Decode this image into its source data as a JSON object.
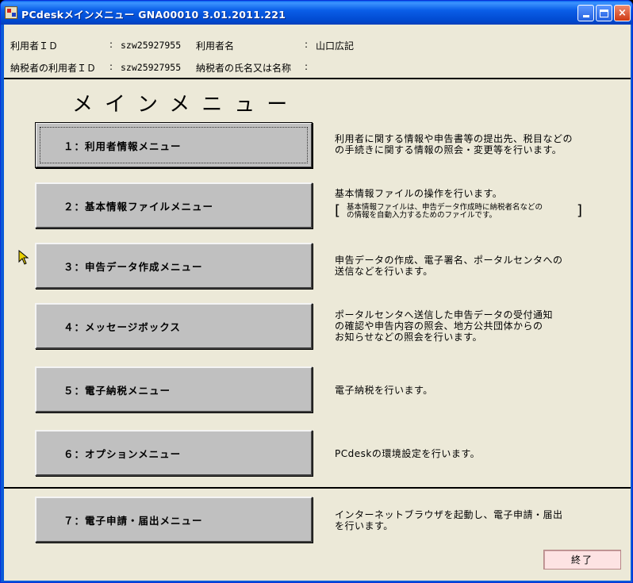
{
  "window": {
    "title": "PCdeskメインメニュー GNA00010  3.01.2011.221",
    "controls": {
      "minimize": "minimize-icon",
      "maximize": "maximize-icon",
      "close": "×"
    }
  },
  "header": {
    "user_id_label": "利用者ＩＤ",
    "user_id_sep": ":",
    "user_id_value": "szw25927955",
    "user_name_label": "利用者名",
    "user_name_sep": ":",
    "user_name_value": "山口広記",
    "taxpayer_id_label": "納税者の利用者ＩＤ",
    "taxpayer_id_sep": ":",
    "taxpayer_id_value": "szw25927955",
    "taxpayer_name_label": "納税者の氏名又は名称",
    "taxpayer_name_sep": ":",
    "taxpayer_name_value": ""
  },
  "menu_title": "メインメニュー",
  "menu": [
    {
      "label": "１：利用者情報メニュー",
      "desc": [
        "利用者に関する情報や申告書等の提出先、税目などの",
        "の手続きに関する情報の照会・変更等を行います。"
      ]
    },
    {
      "label": "２：基本情報ファイルメニュー",
      "desc": [
        "基本情報ファイルの操作を行います。"
      ],
      "note": [
        "基本情報ファイルは、申告データ作成時に納税者名などの",
        "の情報を自動入力するためのファイルです。"
      ]
    },
    {
      "label": "３：申告データ作成メニュー",
      "desc": [
        "申告データの作成、電子署名、ポータルセンタへの",
        "送信などを行います。"
      ]
    },
    {
      "label": "４：メッセージボックス",
      "desc": [
        "ポータルセンタへ送信した申告データの受付通知",
        "の確認や申告内容の照会、地方公共団体からの",
        "お知らせなどの照会を行います。"
      ]
    },
    {
      "label": "５：電子納税メニュー",
      "desc": [
        "電子納税を行います。"
      ]
    },
    {
      "label": "６：オプションメニュー",
      "desc": [
        "PCdeskの環境設定を行います。"
      ]
    },
    {
      "label": "７：電子申請・届出メニュー",
      "desc": [
        "インターネットブラウザを起動し、電子申請・届出",
        "を行います。"
      ]
    }
  ],
  "exit_label": "終了"
}
